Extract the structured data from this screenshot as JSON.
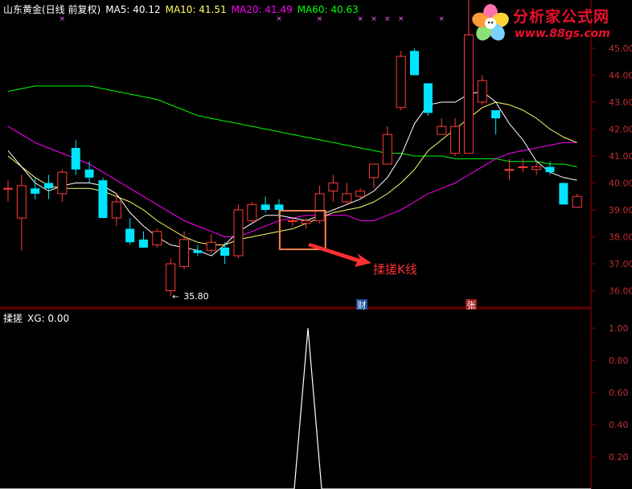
{
  "header": {
    "title": "山东黄金(日线 前复权)",
    "ma5": "MA5: 40.12",
    "ma10": "MA10: 41.51",
    "ma20": "MA20: 41.49",
    "ma60": "MA60: 40.63"
  },
  "indicator": {
    "name": "揉搓",
    "value": "XG: 0.00"
  },
  "annotation": {
    "label": "揉搓K线"
  },
  "low_label": "35.80",
  "markers": {
    "cai": "财",
    "zhang": "张"
  },
  "watermark": {
    "title": "分析家公式网",
    "url": "www.88gs.com"
  },
  "colors": {
    "up": "#ff3b3b",
    "down": "#00e5ff",
    "ma5": "#ffffff",
    "ma10": "#ffff66",
    "ma20": "#ff00ff",
    "ma60": "#00ff00",
    "axis": "#a00000",
    "highlight": "#ff7f50"
  },
  "chart_data": [
    {
      "type": "candlestick",
      "y_ticks": [
        "45.00",
        "44.00",
        "43.00",
        "42.00",
        "41.00",
        "40.00",
        "39.00",
        "38.00",
        "37.00",
        "36.00"
      ],
      "ylim": [
        35.4,
        46.5
      ],
      "candles": [
        [
          39.8,
          40.1,
          39.3,
          39.8
        ],
        [
          38.7,
          40.3,
          37.5,
          39.9
        ],
        [
          39.8,
          40.2,
          39.4,
          39.6
        ],
        [
          40.0,
          40.3,
          39.4,
          39.8
        ],
        [
          39.6,
          40.5,
          39.3,
          40.4
        ],
        [
          41.3,
          41.6,
          40.3,
          40.5
        ],
        [
          40.5,
          40.8,
          40.0,
          40.2
        ],
        [
          40.1,
          40.2,
          38.8,
          38.7
        ],
        [
          38.7,
          39.6,
          38.4,
          39.3
        ],
        [
          38.3,
          38.7,
          37.7,
          37.8
        ],
        [
          37.9,
          38.2,
          37.6,
          37.6
        ],
        [
          37.7,
          38.3,
          37.6,
          38.2
        ],
        [
          36.0,
          37.2,
          35.8,
          37.0
        ],
        [
          36.9,
          38.2,
          36.8,
          37.9
        ],
        [
          37.5,
          37.7,
          37.3,
          37.4
        ],
        [
          37.5,
          38.1,
          37.4,
          37.8
        ],
        [
          37.6,
          37.8,
          37.0,
          37.3
        ],
        [
          37.3,
          39.2,
          37.2,
          39.0
        ],
        [
          38.6,
          39.3,
          38.5,
          39.2
        ],
        [
          39.2,
          39.5,
          38.9,
          39.0
        ],
        [
          39.2,
          39.4,
          38.7,
          39.0
        ],
        [
          38.6,
          38.7,
          38.4,
          38.6
        ],
        [
          38.5,
          38.7,
          38.3,
          38.6
        ],
        [
          38.6,
          39.9,
          38.5,
          39.6
        ],
        [
          39.7,
          40.3,
          39.3,
          40.0
        ],
        [
          39.3,
          40.0,
          39.2,
          39.6
        ],
        [
          39.5,
          39.8,
          39.4,
          39.7
        ],
        [
          40.2,
          40.7,
          39.8,
          40.7
        ],
        [
          40.7,
          42.1,
          40.7,
          41.8
        ],
        [
          42.8,
          44.9,
          42.7,
          44.7
        ],
        [
          44.9,
          45.0,
          44.0,
          44.0
        ],
        [
          43.7,
          43.7,
          42.5,
          42.6
        ],
        [
          41.8,
          42.4,
          41.8,
          42.1
        ],
        [
          41.1,
          42.4,
          41.0,
          42.1
        ],
        [
          41.1,
          46.8,
          41.1,
          45.5
        ],
        [
          43.0,
          44.0,
          42.9,
          43.8
        ],
        [
          42.7,
          42.7,
          41.8,
          42.4
        ],
        [
          40.5,
          40.9,
          40.1,
          40.5
        ],
        [
          40.6,
          40.9,
          40.4,
          40.6
        ],
        [
          40.5,
          40.8,
          40.3,
          40.6
        ],
        [
          40.6,
          40.8,
          40.3,
          40.4
        ],
        [
          40.0,
          40.0,
          39.2,
          39.2
        ],
        [
          39.1,
          39.6,
          39.1,
          39.5
        ]
      ],
      "ma_lines": {
        "MA5": [
          41.2,
          40.6,
          40.0,
          39.7,
          39.9,
          40.0,
          40.0,
          39.9,
          39.6,
          38.9,
          38.4,
          38.0,
          37.7,
          37.6,
          37.5,
          37.3,
          37.7,
          38.2,
          38.5,
          38.8,
          38.8,
          38.7,
          38.6,
          38.8,
          39.0,
          39.2,
          39.4,
          39.7,
          40.2,
          41.0,
          42.2,
          42.9,
          43.0,
          43.0,
          43.3,
          43.4,
          43.0,
          42.2,
          41.6,
          40.8,
          40.4,
          40.2,
          40.1
        ],
        "MA10": [
          41.0,
          40.6,
          40.2,
          39.9,
          39.8,
          39.8,
          39.8,
          39.7,
          39.5,
          39.3,
          39.0,
          38.6,
          38.3,
          38.0,
          37.8,
          37.7,
          37.7,
          37.9,
          38.0,
          38.1,
          38.2,
          38.3,
          38.5,
          38.7,
          38.9,
          39.0,
          39.1,
          39.3,
          39.6,
          40.0,
          40.5,
          41.2,
          41.6,
          42.0,
          42.4,
          42.8,
          43.0,
          42.9,
          42.7,
          42.4,
          42.0,
          41.7,
          41.5
        ],
        "MA20": [
          42.1,
          41.8,
          41.5,
          41.3,
          41.1,
          40.9,
          40.7,
          40.4,
          40.1,
          39.8,
          39.5,
          39.2,
          38.9,
          38.6,
          38.4,
          38.2,
          38.0,
          38.0,
          38.2,
          38.4,
          38.6,
          38.7,
          38.8,
          38.8,
          38.8,
          38.8,
          38.6,
          38.6,
          38.8,
          39.0,
          39.3,
          39.6,
          39.8,
          40.0,
          40.3,
          40.6,
          40.9,
          41.1,
          41.2,
          41.3,
          41.4,
          41.5,
          41.5
        ],
        "MA60": [
          43.4,
          43.5,
          43.6,
          43.6,
          43.6,
          43.6,
          43.6,
          43.5,
          43.4,
          43.3,
          43.2,
          43.1,
          42.9,
          42.7,
          42.5,
          42.4,
          42.3,
          42.2,
          42.1,
          42.0,
          41.9,
          41.8,
          41.7,
          41.6,
          41.5,
          41.4,
          41.3,
          41.2,
          41.1,
          41.1,
          41.0,
          41.0,
          41.0,
          40.9,
          40.9,
          40.9,
          40.9,
          40.8,
          40.8,
          40.8,
          40.7,
          40.7,
          40.6
        ]
      },
      "low_marker": {
        "index": 12,
        "value": 35.8
      },
      "highlight_box": {
        "from_index": 21,
        "to_index": 22
      }
    },
    {
      "type": "line",
      "series": [
        {
          "name": "XG",
          "x": [
            0,
            21,
            22,
            23,
            42
          ],
          "values": [
            0,
            0,
            1,
            0,
            0
          ]
        }
      ],
      "y_ticks": [
        "1.00",
        "0.80",
        "0.60",
        "0.40",
        "0.20"
      ],
      "ylim": [
        0,
        1.05
      ]
    }
  ]
}
